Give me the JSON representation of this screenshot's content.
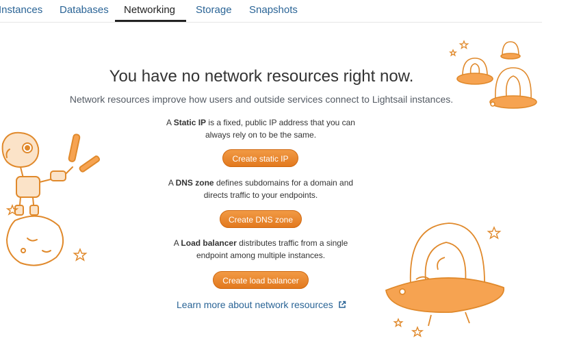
{
  "tabs": [
    {
      "label": "Instances",
      "active": false
    },
    {
      "label": "Databases",
      "active": false
    },
    {
      "label": "Networking",
      "active": true
    },
    {
      "label": "Storage",
      "active": false
    },
    {
      "label": "Snapshots",
      "active": false
    }
  ],
  "empty_state": {
    "title": "You have no network resources right now.",
    "subtitle": "Network resources improve how users and outside services connect to Lightsail instances."
  },
  "sections": {
    "static_ip": {
      "prefix": "A ",
      "term": "Static IP",
      "line1_rest": " is a fixed, public IP address that you can",
      "line2": "always rely on to be the same.",
      "button": "Create static IP"
    },
    "dns_zone": {
      "prefix": "A ",
      "term": "DNS zone",
      "line1_rest": " defines subdomains for a domain and",
      "line2": "directs traffic to your endpoints.",
      "button": "Create DNS zone"
    },
    "load_balancer": {
      "prefix": "A ",
      "term": "Load balancer",
      "line1_rest": " distributes traffic from a single",
      "line2": "endpoint among multiple instances.",
      "button": "Create load balancer"
    }
  },
  "learn_more": {
    "label": "Learn more about network resources",
    "icon": "external-link-icon"
  },
  "colors": {
    "accent_orange": "#ec7211",
    "link_blue": "#2a6496",
    "illustration_line": "#e0892b",
    "illustration_fill": "#f6a351"
  },
  "illustrations": {
    "left": "robot-on-planet-illustration",
    "top_right": "astronauts-in-domes-illustration",
    "bottom_right": "astronaut-in-ufo-illustration"
  }
}
